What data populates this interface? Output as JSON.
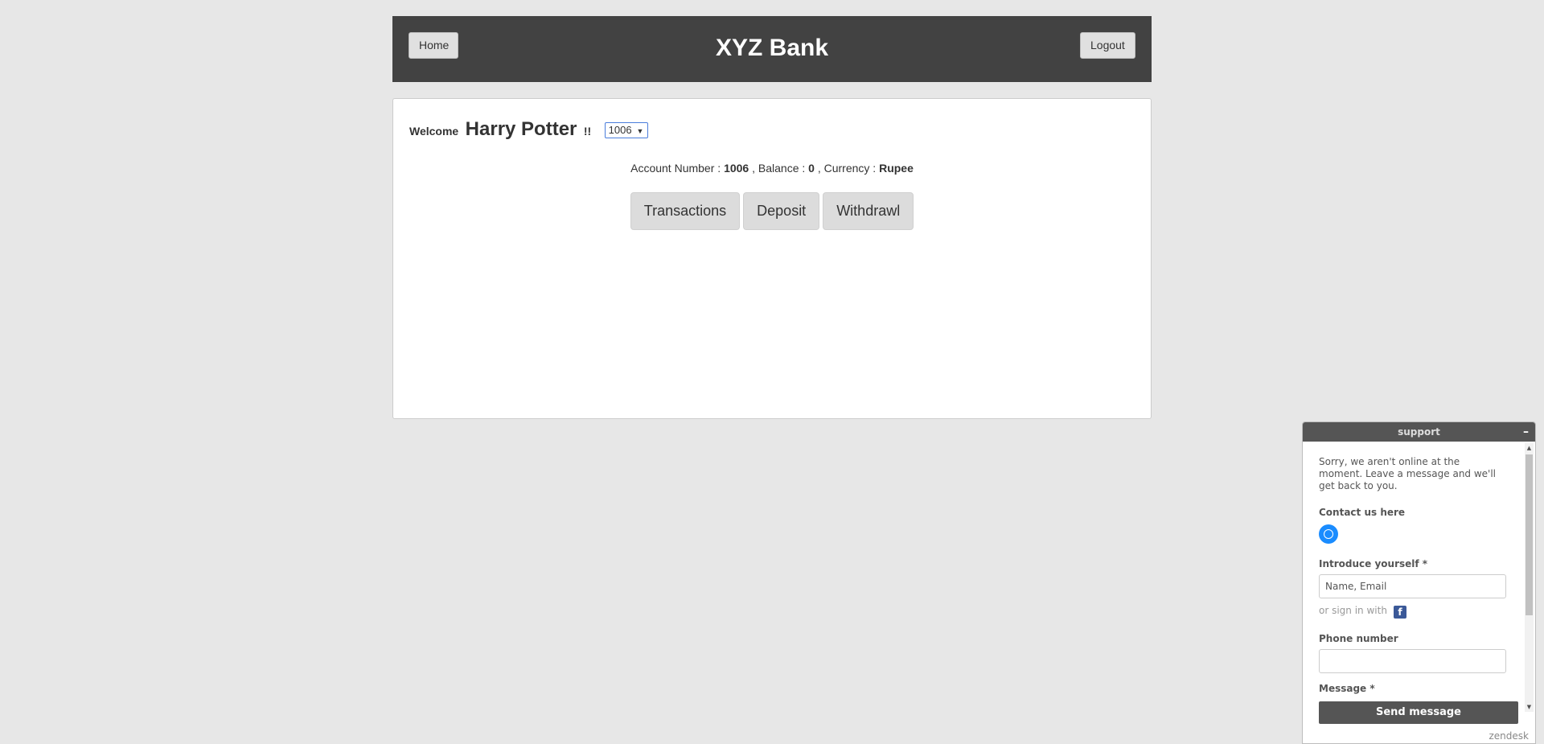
{
  "header": {
    "home_label": "Home",
    "title": "XYZ Bank",
    "logout_label": "Logout"
  },
  "customer": {
    "welcome": "Welcome",
    "name": "Harry Potter",
    "exclaim": "!!",
    "selected_account": "1006"
  },
  "account_info": {
    "number_label": "Account Number :",
    "number": "1006",
    "balance_label": ", Balance :",
    "balance": "0",
    "currency_label": ", Currency :",
    "currency": "Rupee"
  },
  "actions": {
    "transactions": "Transactions",
    "deposit": "Deposit",
    "withdrawl": "Withdrawl"
  },
  "support": {
    "title": "support",
    "minimize": "–",
    "offline_text": "Sorry, we aren't online at the moment. Leave a message and we'll get back to you.",
    "contact_label": "Contact us here",
    "introduce_label": "Introduce yourself *",
    "introduce_placeholder": "Name, Email",
    "signin_text": "or sign in with",
    "phone_label": "Phone number",
    "message_label": "Message *",
    "send_label": "Send message",
    "brand": "zendesk"
  },
  "colors": {
    "page_bg": "#e7e7e7",
    "header_bg": "#424242",
    "button_bg": "#dcdcdc",
    "support_accent": "#555555"
  }
}
